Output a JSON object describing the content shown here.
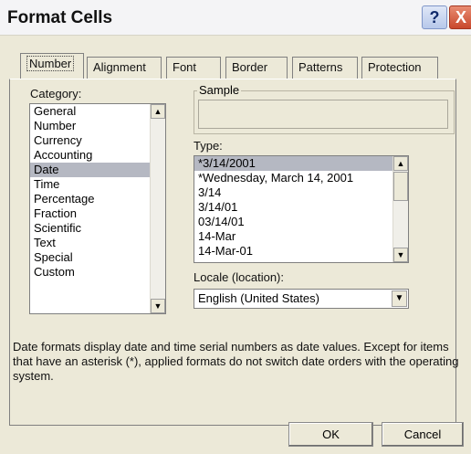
{
  "window": {
    "title": "Format Cells",
    "help_glyph": "?",
    "close_glyph": "X"
  },
  "tabs": [
    {
      "label": "Number",
      "active": true
    },
    {
      "label": "Alignment"
    },
    {
      "label": "Font"
    },
    {
      "label": "Border"
    },
    {
      "label": "Patterns"
    },
    {
      "label": "Protection"
    }
  ],
  "category": {
    "label": "Category:",
    "items": [
      "General",
      "Number",
      "Currency",
      "Accounting",
      "Date",
      "Time",
      "Percentage",
      "Fraction",
      "Scientific",
      "Text",
      "Special",
      "Custom"
    ],
    "selected": "Date"
  },
  "sample": {
    "label": "Sample",
    "value": ""
  },
  "type": {
    "label": "Type:",
    "items": [
      "*3/14/2001",
      "*Wednesday, March 14, 2001",
      "3/14",
      "3/14/01",
      "03/14/01",
      "14-Mar",
      "14-Mar-01"
    ],
    "selected": "*3/14/2001"
  },
  "locale": {
    "label": "Locale (location):",
    "value": "English (United States)"
  },
  "description": "Date formats display date and time serial numbers as date values. Except for items that have an asterisk (*), applied formats do not switch date orders with the operating system.",
  "buttons": {
    "ok": "OK",
    "cancel": "Cancel"
  }
}
